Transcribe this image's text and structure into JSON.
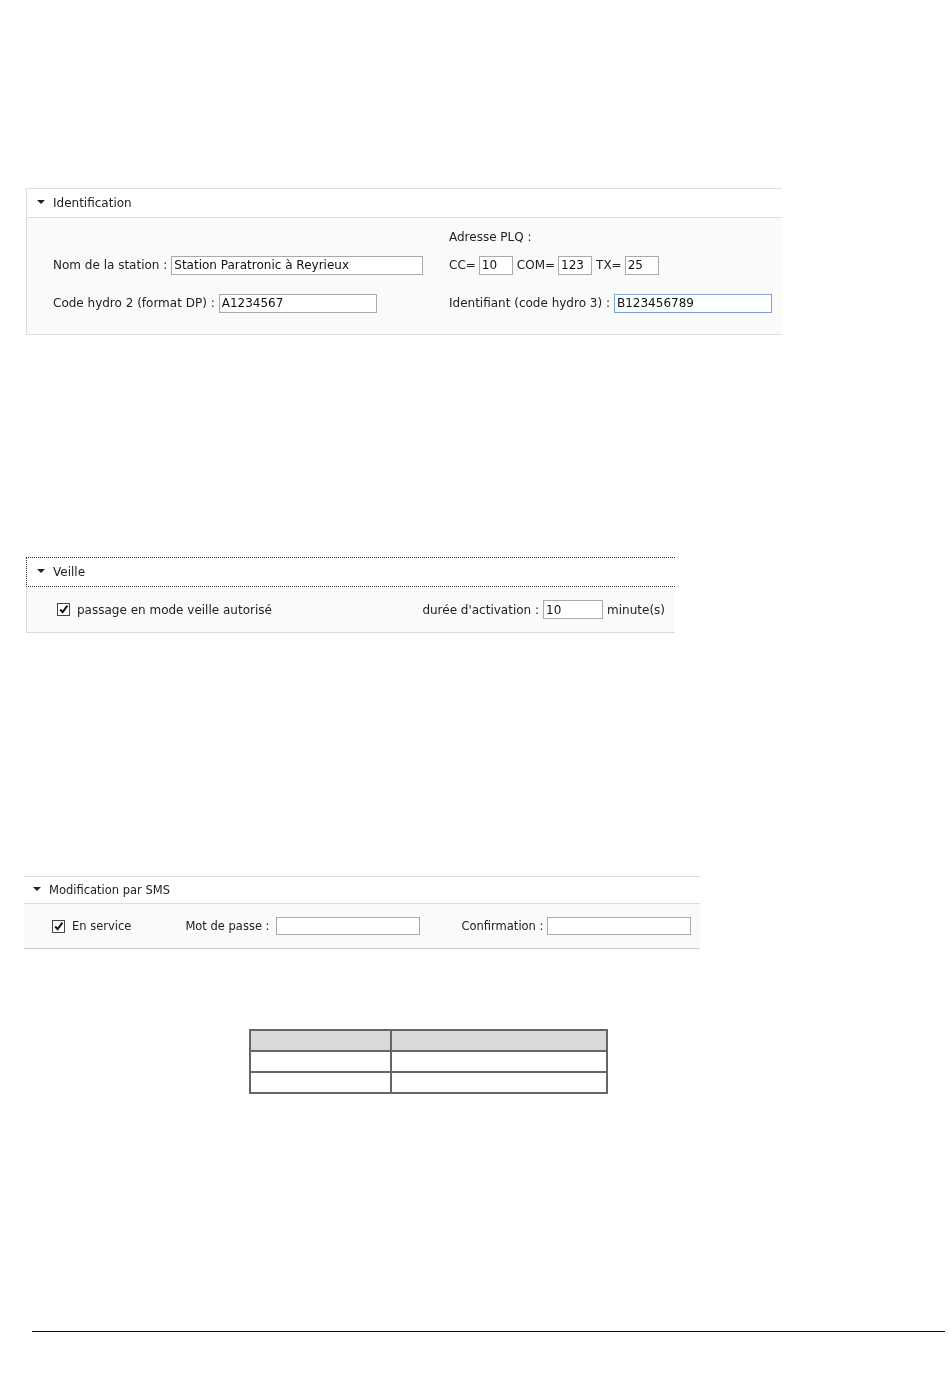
{
  "identification": {
    "title": "Identification",
    "expanded": true,
    "station_name": {
      "label": "Nom de la station :",
      "value": "Station Paratronic à Reyrieux"
    },
    "code_hydro2": {
      "label": "Code hydro 2 (format DP) :",
      "value": "A1234567"
    },
    "plq": {
      "label": "Adresse PLQ :",
      "fields": [
        {
          "label": "CC=",
          "value": "10"
        },
        {
          "label": "COM=",
          "value": "123"
        },
        {
          "label": "TX=",
          "value": "25"
        }
      ]
    },
    "identifier": {
      "label": "Identifiant (code hydro 3) :",
      "value": "B123456789",
      "focused": true
    }
  },
  "veille": {
    "title": "Veille",
    "expanded": true,
    "standby": {
      "label": "passage en mode veille autorisé",
      "checked": true
    },
    "duration": {
      "label": "durée d'activation :",
      "value": "10",
      "unit": "minute(s)"
    }
  },
  "sms": {
    "title": "Modification par SMS",
    "expanded": true,
    "in_service": {
      "label": "En service",
      "checked": true
    },
    "password": {
      "label": "Mot de passe :"
    },
    "confirmation": {
      "label": "Confirmation :"
    }
  }
}
